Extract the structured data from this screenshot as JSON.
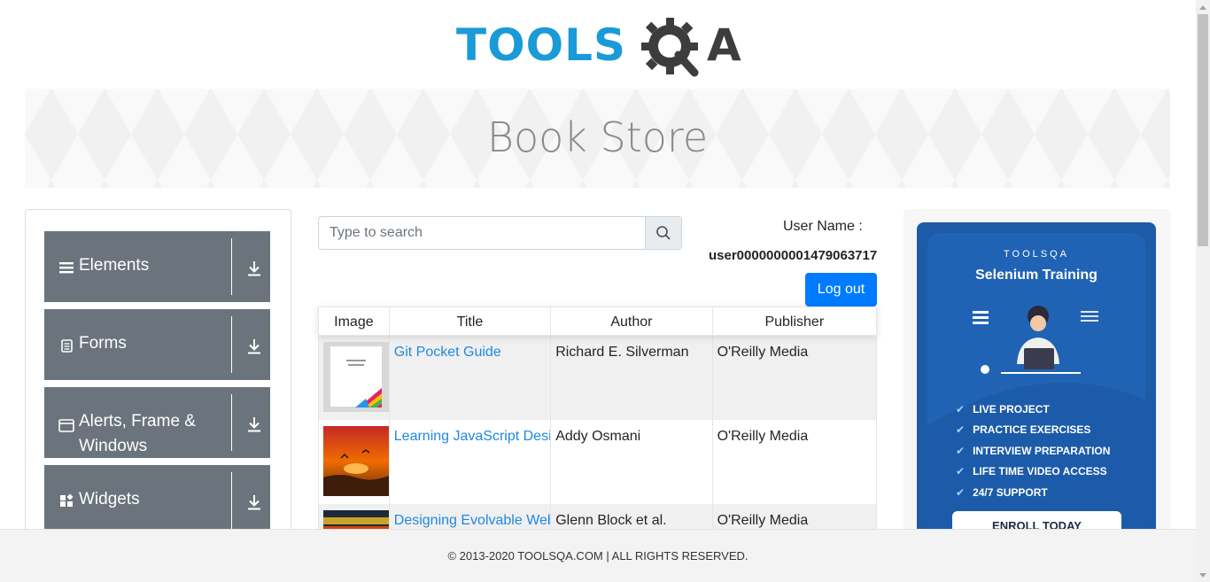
{
  "logo": {
    "part1": "TOOLS",
    "part2": "A"
  },
  "banner": {
    "title": "Book Store"
  },
  "nav": [
    {
      "label": "Elements",
      "icon": "hamburger-icon"
    },
    {
      "label": "Forms",
      "icon": "document-icon"
    },
    {
      "label": "Alerts, Frame & Windows",
      "icon": "window-icon"
    },
    {
      "label": "Widgets",
      "icon": "widgets-icon"
    }
  ],
  "search": {
    "placeholder": "Type to search",
    "value": ""
  },
  "user": {
    "label": "User Name :",
    "value": "user0000000001479063717"
  },
  "logout_label": "Log out",
  "table": {
    "headers": [
      "Image",
      "Title",
      "Author",
      "Publisher"
    ],
    "rows": [
      {
        "title": "Git Pocket Guide",
        "author": "Richard E. Silverman",
        "publisher": "O'Reilly Media"
      },
      {
        "title": "Learning JavaScript Design Patterns",
        "author": "Addy Osmani",
        "publisher": "O'Reilly Media"
      },
      {
        "title": "Designing Evolvable Web APIs with ASP.NET",
        "author": "Glenn Block et al.",
        "publisher": "O'Reilly Media"
      }
    ]
  },
  "ad": {
    "brand": "TOOLSQA",
    "title": "Selenium Training",
    "features": [
      "LIVE PROJECT",
      "PRACTICE EXERCISES",
      "INTERVIEW PREPARATION",
      "LIFE TIME VIDEO ACCESS",
      "24/7 SUPPORT"
    ],
    "cta": "ENROLL TODAY"
  },
  "footer": "© 2013-2020 TOOLSQA.COM | ALL RIGHTS RESERVED.",
  "colors": {
    "logo_blue": "#1a9ad6",
    "nav_bg": "#6b747c",
    "primary": "#007bff",
    "link": "#1e88e5",
    "ad_blue": "#1d5aa8"
  }
}
